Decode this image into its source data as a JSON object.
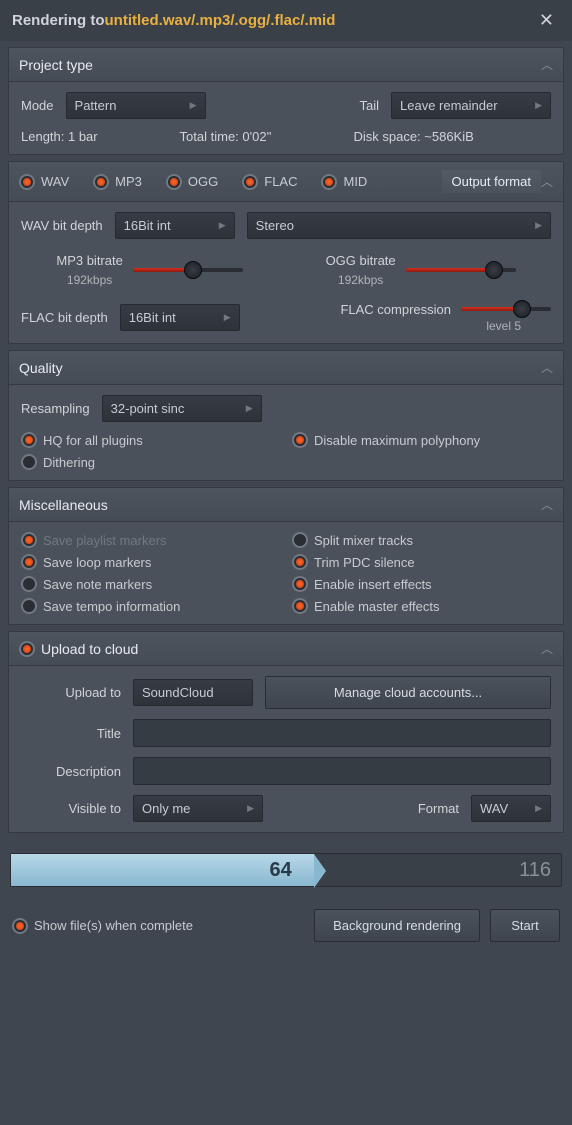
{
  "titlebar": {
    "prefix": "Rendering to ",
    "file": "untitled.wav/.mp3/.ogg/.flac/.mid"
  },
  "project_type": {
    "title": "Project type",
    "mode_label": "Mode",
    "mode_value": "Pattern",
    "tail_label": "Tail",
    "tail_value": "Leave remainder",
    "length": "Length: 1 bar",
    "total_time": "Total time: 0'02''",
    "disk_space": "Disk space: ~586KiB"
  },
  "output_format": {
    "title": "Output format",
    "formats": [
      "WAV",
      "MP3",
      "OGG",
      "FLAC",
      "MID"
    ],
    "wav_bit_depth_label": "WAV bit depth",
    "wav_bit_depth_value": "16Bit int",
    "stereo_value": "Stereo",
    "mp3_bitrate_label": "MP3 bitrate",
    "mp3_bitrate_value": "192kbps",
    "ogg_bitrate_label": "OGG bitrate",
    "ogg_bitrate_value": "192kbps",
    "flac_bit_depth_label": "FLAC bit depth",
    "flac_bit_depth_value": "16Bit int",
    "flac_comp_label": "FLAC compression",
    "flac_comp_value": "level 5"
  },
  "quality": {
    "title": "Quality",
    "resampling_label": "Resampling",
    "resampling_value": "32-point sinc",
    "hq_label": "HQ for all plugins",
    "disable_poly_label": "Disable maximum polyphony",
    "dithering_label": "Dithering"
  },
  "misc": {
    "title": "Miscellaneous",
    "save_playlist": "Save playlist markers",
    "split_mixer": "Split mixer tracks",
    "save_loop": "Save loop markers",
    "trim_pdc": "Trim PDC silence",
    "save_note": "Save note markers",
    "enable_insert": "Enable insert effects",
    "save_tempo": "Save tempo information",
    "enable_master": "Enable master effects"
  },
  "cloud": {
    "title": "Upload to cloud",
    "upload_to_label": "Upload to",
    "upload_to_value": "SoundCloud",
    "manage_label": "Manage cloud accounts...",
    "title_label": "Title",
    "desc_label": "Description",
    "visible_label": "Visible to",
    "visible_value": "Only me",
    "format_label": "Format",
    "format_value": "WAV"
  },
  "progress": {
    "current": "64",
    "total": "116",
    "percent": 55
  },
  "bottom": {
    "show_file_label": "Show file(s) when complete",
    "background_label": "Background rendering",
    "start_label": "Start"
  }
}
